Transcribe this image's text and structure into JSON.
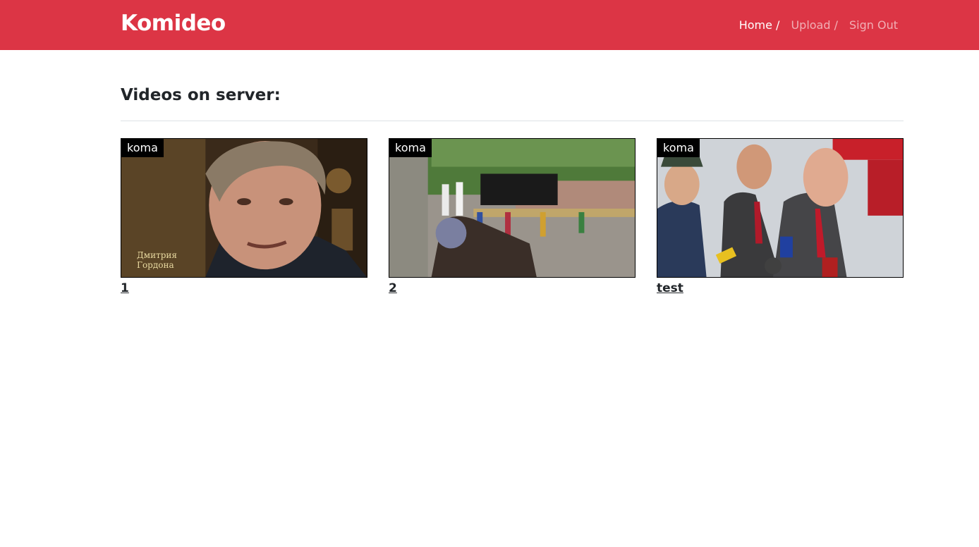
{
  "app": {
    "brand": "Komideo"
  },
  "nav": {
    "home": "Home /",
    "upload": "Upload /",
    "signout": "Sign Out"
  },
  "main": {
    "heading": "Videos on server:"
  },
  "videos": [
    {
      "badge": "koma",
      "title": "1",
      "caption": "Дмитрия Гордона"
    },
    {
      "badge": "koma",
      "title": "2"
    },
    {
      "badge": "koma",
      "title": "test"
    }
  ],
  "colors": {
    "navbar": "#dc3545",
    "text": "#212529"
  }
}
